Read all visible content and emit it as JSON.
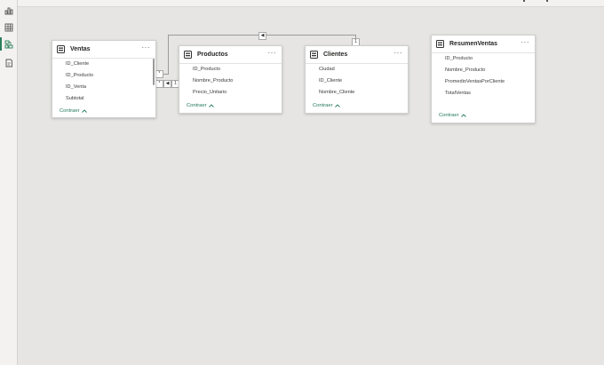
{
  "nav": {
    "items": [
      {
        "icon": "report-view-icon"
      },
      {
        "icon": "table-view-icon"
      },
      {
        "icon": "model-view-icon",
        "active": true
      },
      {
        "icon": "dax-query-icon"
      }
    ]
  },
  "tables": {
    "ventas": {
      "title": "Ventas",
      "fields": [
        "ID_Cliente",
        "ID_Producto",
        "ID_Venta",
        "Subtotal"
      ],
      "collapse_label": "Contraer"
    },
    "productos": {
      "title": "Productos",
      "fields": [
        "ID_Producto",
        "Nombre_Producto",
        "Precio_Unitario"
      ],
      "collapse_label": "Contraer"
    },
    "clientes": {
      "title": "Clientes",
      "fields": [
        "Ciudad",
        "ID_Cliente",
        "Nombre_Cliente"
      ],
      "collapse_label": "Contraer"
    },
    "resumen": {
      "title": "ResumenVentas",
      "fields": [
        "ID_Producto",
        "Nombre_Producto",
        "PromedioVentasPorCliente",
        "TotalVentas"
      ],
      "collapse_label": "Contraer"
    }
  },
  "relationships": {
    "ventas_clientes_many": "*",
    "ventas_clientes_one": "1",
    "ventas_productos_many": "*",
    "ventas_productos_one": "1"
  },
  "colors": {
    "accent": "#21795a",
    "canvas": "#e6e5e4"
  }
}
